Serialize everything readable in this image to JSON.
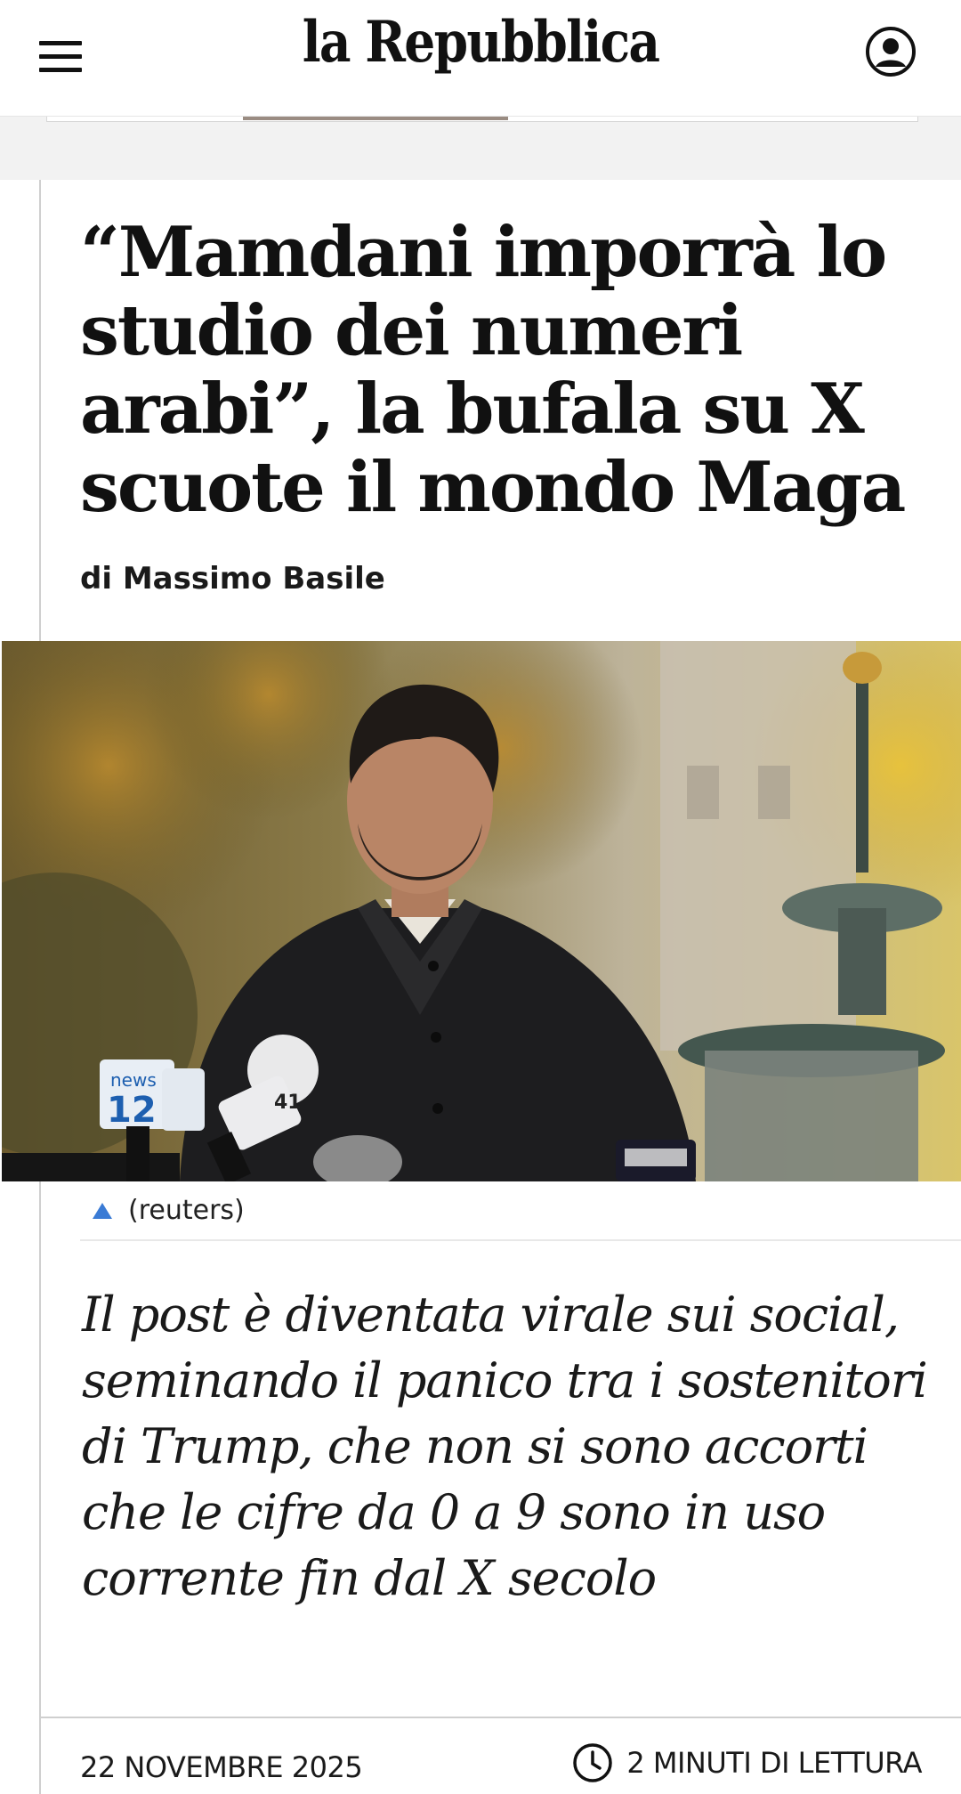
{
  "header": {
    "logo": "la Repubblica",
    "menu_icon": "hamburger-menu-icon",
    "account_icon": "user-account-icon"
  },
  "article": {
    "headline": "“Mamdani imporrà lo studio dei numeri arabi”, la bufala su X scuote il mondo Maga",
    "byline": "di Massimo Basile",
    "photo_caption": "(reuters)",
    "summary": "Il post è diventata virale sui social, seminando il panico tra i sostenitori di Trump, che non si sono accorti che le cifre da 0 a 9 sono in uso corrente fin dal X secolo",
    "date": "22 NOVEMBRE 2025",
    "read_time": "2 MINUTI DI LETTURA",
    "read_time_icon": "clock-icon"
  },
  "photo": {
    "mic_labels": [
      "news",
      "12",
      "41"
    ]
  },
  "colors": {
    "caption_accent": "#3a7bd5",
    "text": "#111111",
    "strip": "#f2f2f2"
  }
}
